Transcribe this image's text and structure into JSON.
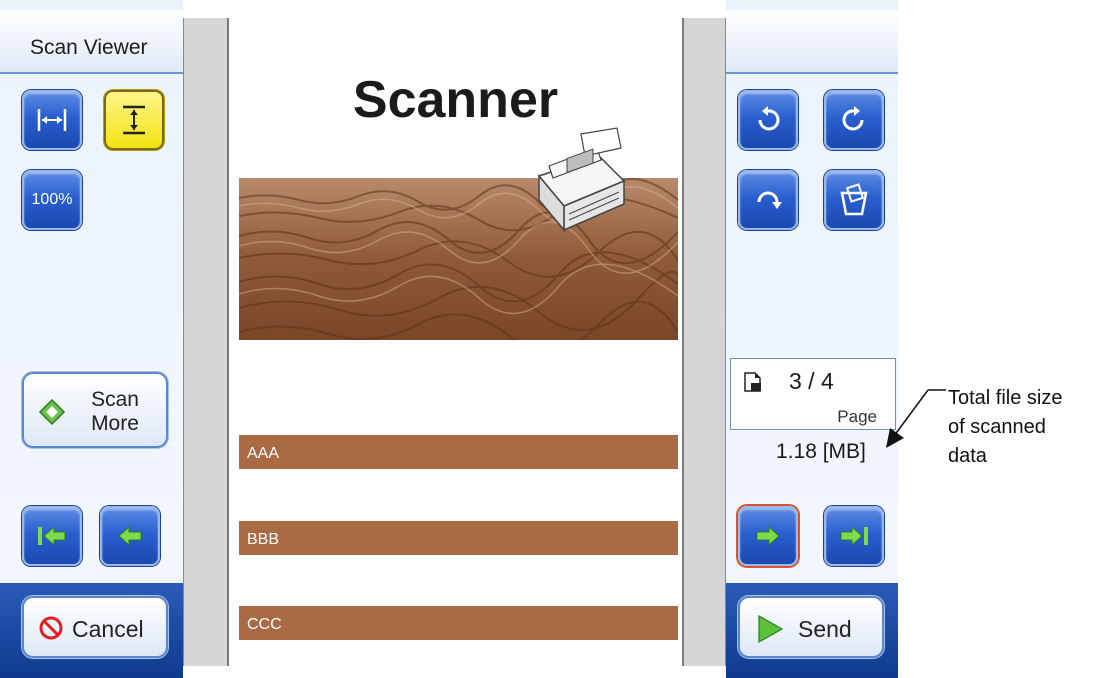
{
  "app": {
    "title": "Scan Viewer"
  },
  "left_panel": {
    "fit_width_icon": "fit-width-icon",
    "fit_height_icon": "fit-height-icon",
    "zoom_100_label": "100%",
    "scan_more_label_line1": "Scan",
    "scan_more_label_line2": "More",
    "cancel_label": "Cancel"
  },
  "right_panel": {
    "page_counter": "3 / 4",
    "page_label": "Page",
    "file_size": "1.18 [MB]",
    "send_label": "Send"
  },
  "document": {
    "title": "Scanner",
    "bars": [
      "AAA",
      "BBB",
      "CCC"
    ]
  },
  "annotation": {
    "line1": "Total file size",
    "line2": "of scanned",
    "line3": "data"
  },
  "colors": {
    "button_blue": "#2a5fcf",
    "selected_yellow": "#f2e313",
    "footer_blue": "#1f4ea8",
    "doc_bar_brown": "#a96a44"
  }
}
